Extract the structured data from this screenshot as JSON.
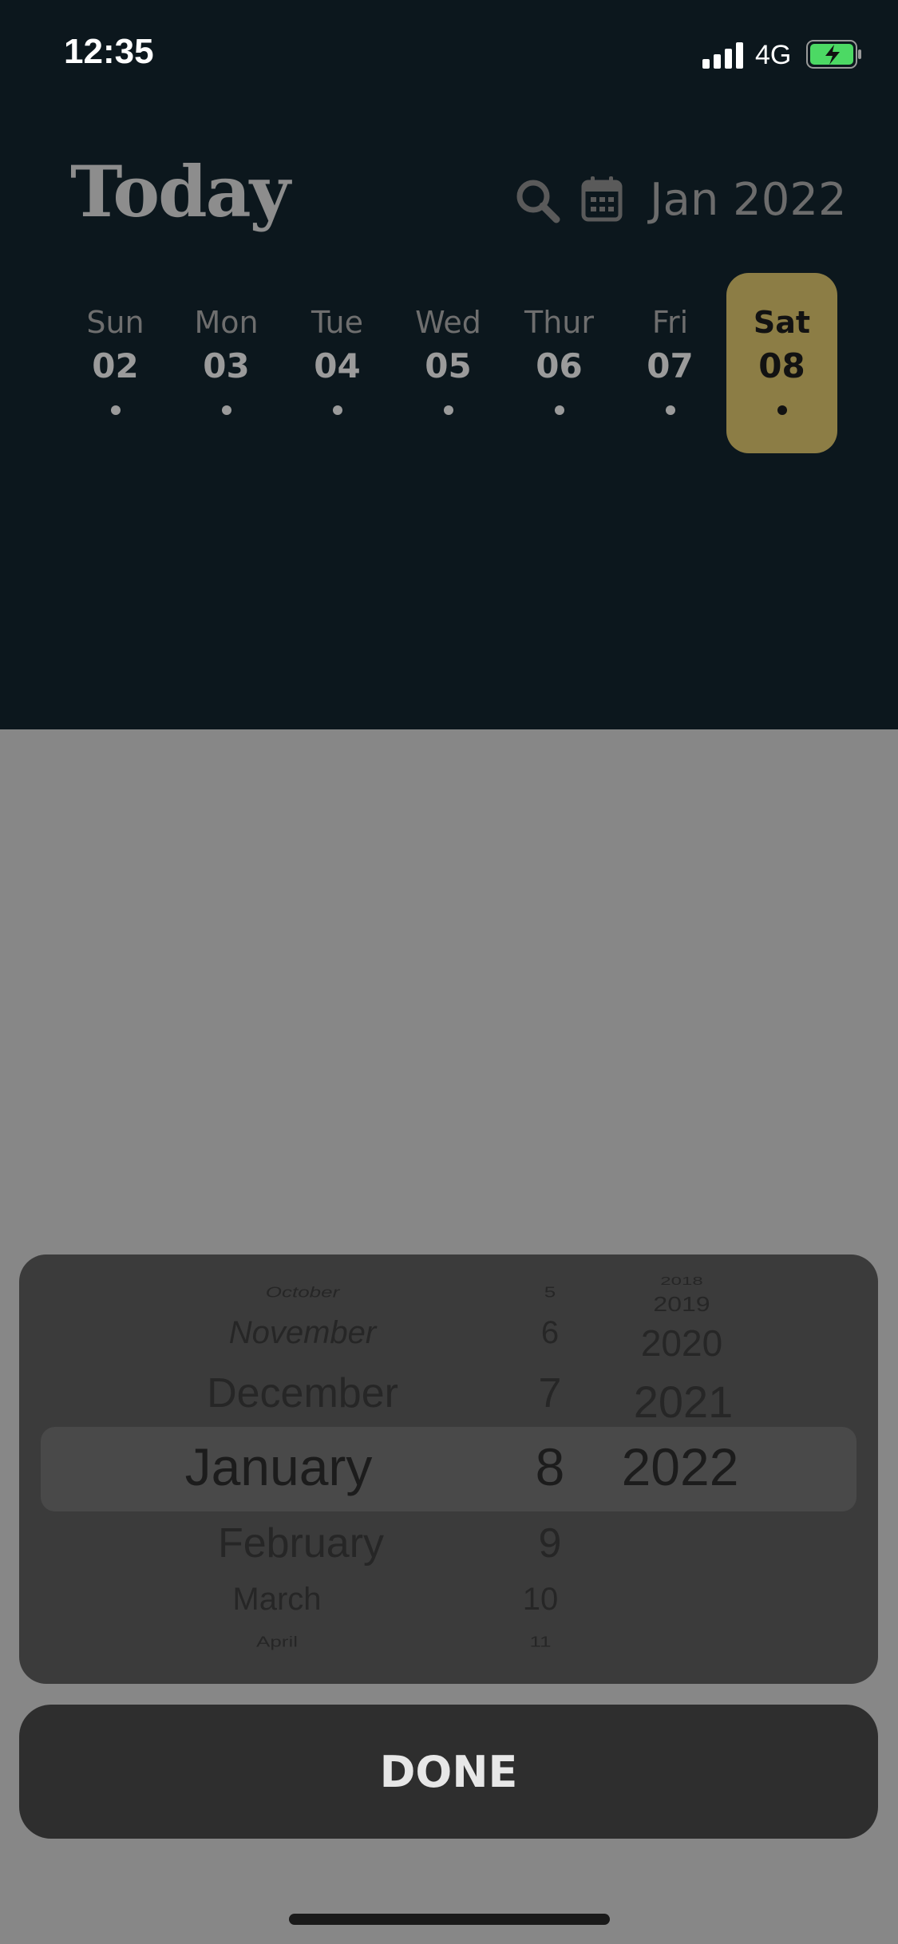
{
  "status": {
    "time": "12:35",
    "network": "4G"
  },
  "header": {
    "title": "Today",
    "month_label": "Jan 2022"
  },
  "week": [
    {
      "day": "Sun",
      "date": "02",
      "selected": false
    },
    {
      "day": "Mon",
      "date": "03",
      "selected": false
    },
    {
      "day": "Tue",
      "date": "04",
      "selected": false
    },
    {
      "day": "Wed",
      "date": "05",
      "selected": false
    },
    {
      "day": "Thur",
      "date": "06",
      "selected": false
    },
    {
      "day": "Fri",
      "date": "07",
      "selected": false
    },
    {
      "day": "Sat",
      "date": "08",
      "selected": true
    }
  ],
  "picker": {
    "months": [
      "October",
      "November",
      "December",
      "January",
      "February",
      "March",
      "April"
    ],
    "days": [
      "5",
      "6",
      "7",
      "8",
      "9",
      "10",
      "11"
    ],
    "years": [
      "2018",
      "2019",
      "2020",
      "2021",
      "2022"
    ],
    "selected": {
      "month": "January",
      "day": "8",
      "year": "2022"
    }
  },
  "done_label": "DONE",
  "colors": {
    "accent": "#8c7d45",
    "background": "#0c171d",
    "overlay": "#878787"
  }
}
